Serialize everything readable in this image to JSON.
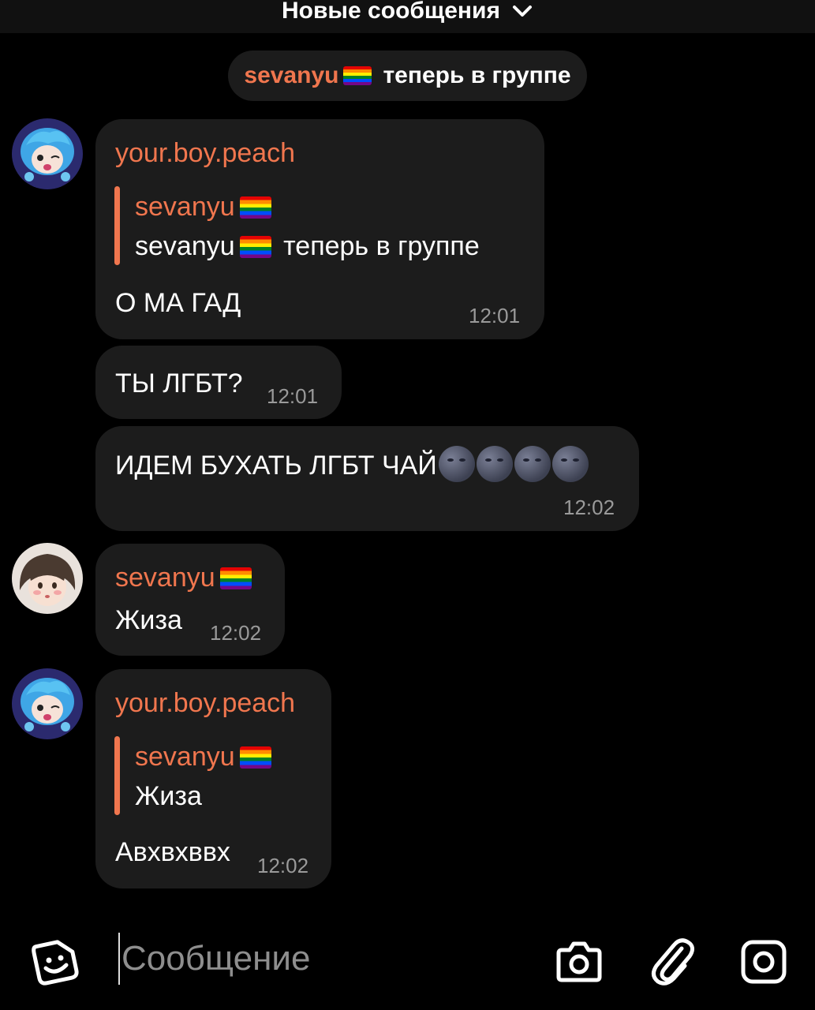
{
  "top_banner": {
    "title": "Новые сообщения",
    "icon": "chevron-down-icon"
  },
  "system_message": {
    "name": "sevanyu",
    "text": "теперь в группе"
  },
  "messages": [
    {
      "sender": "your.boy.peach",
      "reply": {
        "name": "sevanyu",
        "text_name": "sevanyu",
        "text": "теперь в группе"
      },
      "text": "О МА ГАД",
      "time": "12:01"
    },
    {
      "text": "ТЫ ЛГБТ?",
      "time": "12:01"
    },
    {
      "text": "ИДЕМ БУХАТЬ ЛГБТ ЧАЙ",
      "time": "12:02"
    },
    {
      "sender": "sevanyu",
      "text": "Жиза",
      "time": "12:02"
    },
    {
      "sender": "your.boy.peach",
      "reply": {
        "name": "sevanyu",
        "text": "Жиза"
      },
      "text": "Авхвхввх",
      "time": "12:02"
    }
  ],
  "composer": {
    "placeholder": "Сообщение",
    "icons": [
      "sticker-icon",
      "camera-icon",
      "paperclip-icon",
      "gallery-icon"
    ]
  },
  "colors": {
    "accent": "#f0764e",
    "bubble": "#1c1c1c",
    "background": "#000000",
    "time": "#9a9a9a"
  }
}
